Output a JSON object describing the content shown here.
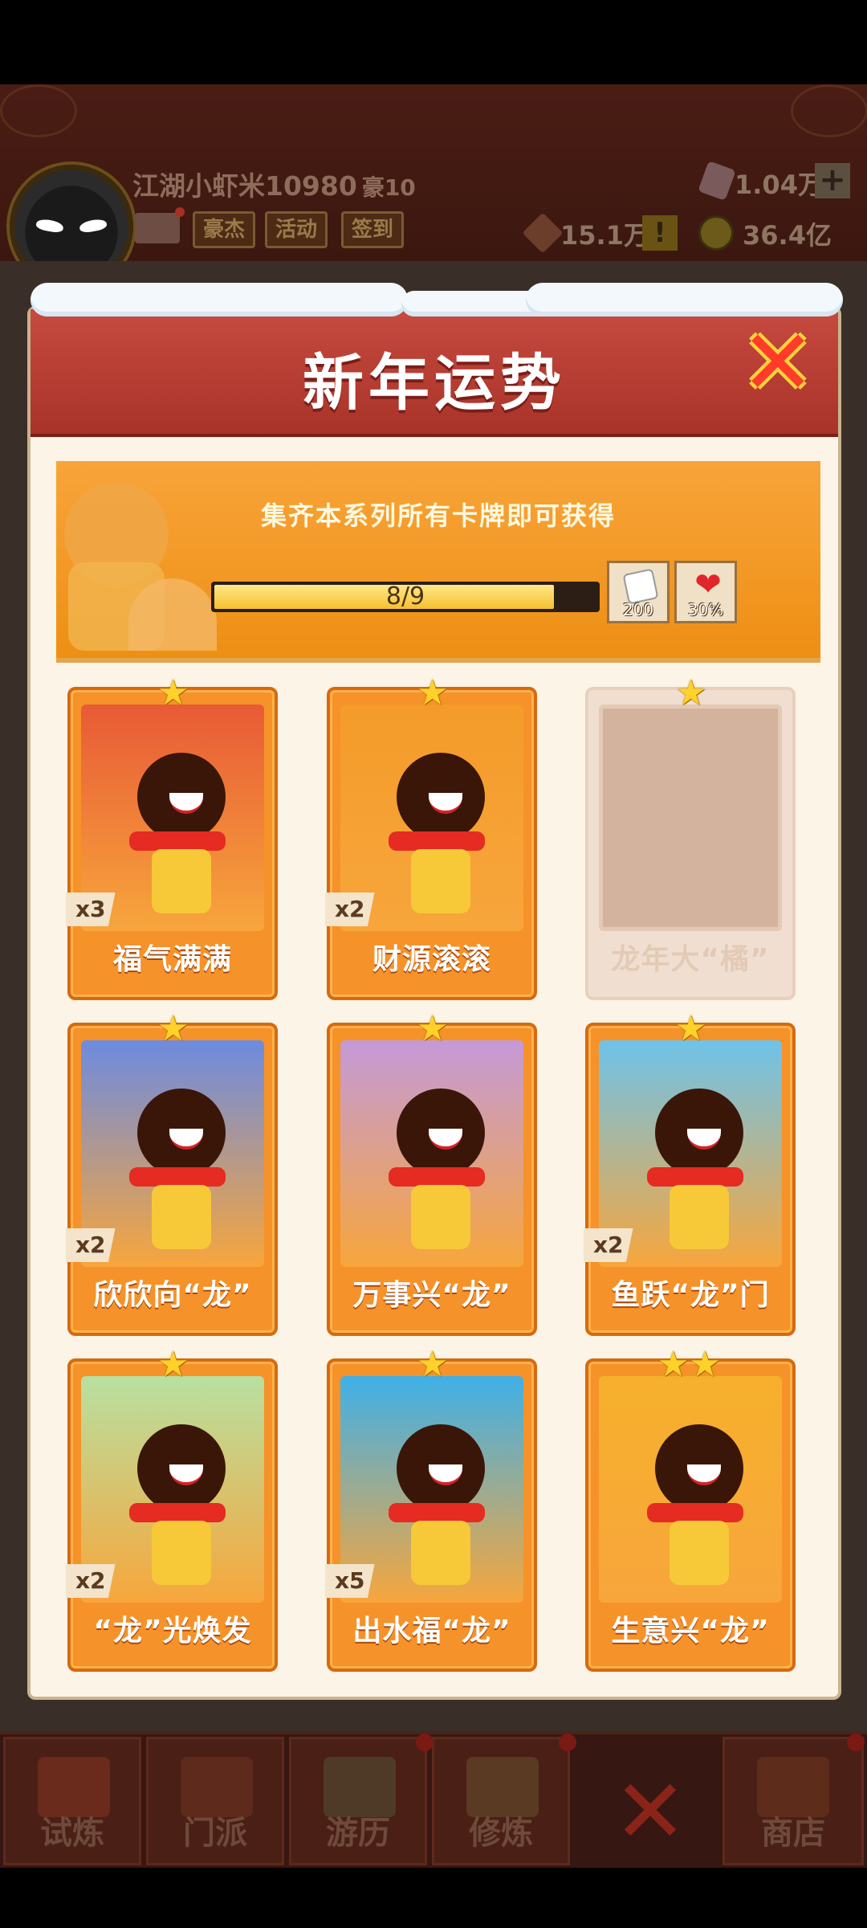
{
  "header": {
    "player_name": "江湖小虾米10980",
    "rank": "豪10",
    "buttons": [
      "豪杰",
      "活动",
      "签到"
    ],
    "gems": "1.04万",
    "power": "15.1万",
    "coins": "36.4亿",
    "plus": "+",
    "alert": "!"
  },
  "modal": {
    "title": "新年运势",
    "close": "✕",
    "banner_text": "集齐本系列所有卡牌即可获得",
    "progress": {
      "text": "8/9",
      "fraction": 0.889
    },
    "rewards": [
      {
        "icon": "dice-icon",
        "value": "200"
      },
      {
        "icon": "heart-icon",
        "value": "30%"
      }
    ],
    "cards": [
      {
        "name": "福气满满",
        "count": "x3",
        "stars": "★",
        "locked": false,
        "bg": "#e85a36"
      },
      {
        "name": "财源滚滚",
        "count": "x2",
        "stars": "★",
        "locked": false,
        "bg": "#f49b2a"
      },
      {
        "name": "龙年大“橘”",
        "count": "",
        "stars": "★",
        "locked": true,
        "bg": "#d4b39e"
      },
      {
        "name": "欣欣向“龙”",
        "count": "x2",
        "stars": "★",
        "locked": false,
        "bg": "#6d8be0"
      },
      {
        "name": "万事兴“龙”",
        "count": "",
        "stars": "★",
        "locked": false,
        "bg": "#c49ad8"
      },
      {
        "name": "鱼跃“龙”门",
        "count": "x2",
        "stars": "★",
        "locked": false,
        "bg": "#6ec3ea"
      },
      {
        "name": "“龙”光焕发",
        "count": "x2",
        "stars": "★",
        "locked": false,
        "bg": "#b8e0a0"
      },
      {
        "name": "出水福“龙”",
        "count": "x5",
        "stars": "★",
        "locked": false,
        "bg": "#3fb0e8"
      },
      {
        "name": "生意兴“龙”",
        "count": "",
        "stars": "★★",
        "locked": false,
        "bg": "#f7b02c"
      }
    ]
  },
  "nav": {
    "items": [
      "试炼",
      "门派",
      "游历",
      "修炼",
      "商店"
    ],
    "close": "✕"
  }
}
